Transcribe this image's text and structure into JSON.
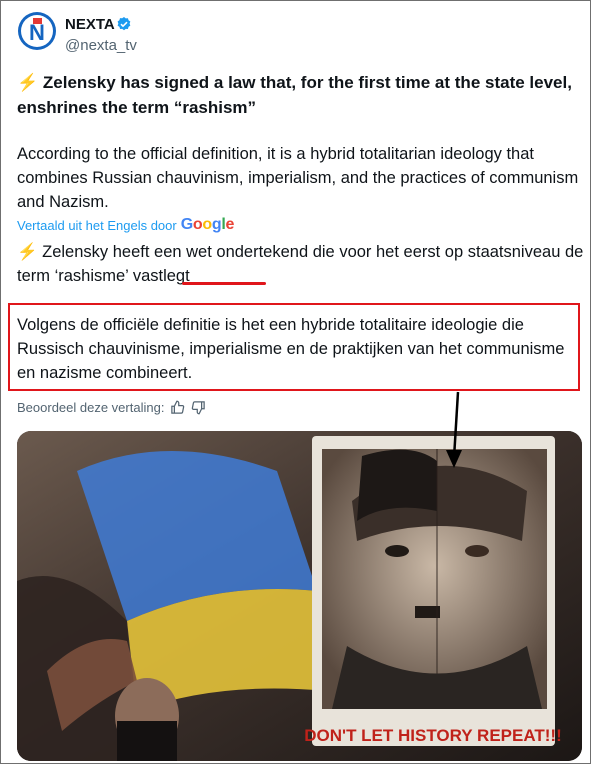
{
  "account": {
    "name": "NEXTA",
    "handle": "@nexta_tv",
    "avatar_letter": "N",
    "verified_color": "#1d9bf0"
  },
  "tweet": {
    "headline": "⚡️ Zelensky has signed a law that, for the first time at the state level, enshrines the term “rashism”",
    "body": "According to the official definition, it is a hybrid totalitarian ideology that combines Russian chauvinism, imperialism, and the practices of communism and Nazism."
  },
  "translation": {
    "label": "Vertaald uit het Engels door",
    "google": [
      "G",
      "o",
      "o",
      "g",
      "l",
      "e"
    ],
    "line1": "⚡️ Zelensky heeft een wet ondertekend die voor het eerst op staatsniveau de term ‘rashisme’ vastlegt",
    "line2": "Volgens de officiële definitie is het een hybride totalitaire ideologie die Russisch chauvinisme, imperialisme en de praktijken van het communisme en nazisme combineert.",
    "rate_label": "Beoordeel deze vertaling:"
  },
  "image": {
    "sign_text": "DON'T LET HISTORY REPEAT!!!"
  },
  "colors": {
    "annotation_red": "#e0161b",
    "link_blue": "#1d9bf0",
    "muted": "#536471"
  }
}
